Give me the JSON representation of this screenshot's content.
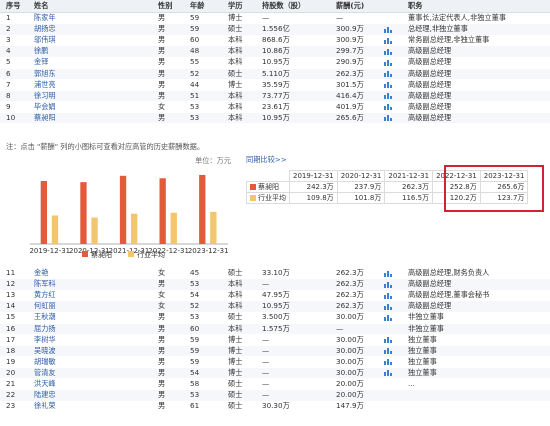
{
  "header": [
    "序号",
    "姓名",
    "性别",
    "年龄",
    "学历",
    "持股数（股）",
    "薪酬(元)",
    "",
    "职务"
  ],
  "top_rows": [
    [
      "1",
      "陈家年",
      "男",
      "59",
      "博士",
      "—",
      "—",
      "",
      "董事长,法定代表人,非独立董事"
    ],
    [
      "2",
      "胡扬忠",
      "男",
      "59",
      "硕士",
      "1.556亿",
      "300.9万",
      "chart",
      "总经理,非独立董事"
    ],
    [
      "3",
      "邬伟琪",
      "男",
      "60",
      "本科",
      "868.6万",
      "300.9万",
      "chart",
      "常务副总经理,非独立董事"
    ],
    [
      "4",
      "徐鹏",
      "男",
      "48",
      "本科",
      "10.86万",
      "299.7万",
      "chart",
      "高级副总经理"
    ],
    [
      "5",
      "金铎",
      "男",
      "55",
      "本科",
      "10.95万",
      "290.9万",
      "chart",
      "高级副总经理"
    ],
    [
      "6",
      "郭旭东",
      "男",
      "52",
      "硕士",
      "5.110万",
      "262.3万",
      "chart",
      "高级副总经理"
    ],
    [
      "7",
      "浦世亮",
      "男",
      "44",
      "博士",
      "35.59万",
      "301.5万",
      "chart",
      "高级副总经理"
    ],
    [
      "8",
      "徐习明",
      "男",
      "51",
      "本科",
      "73.77万",
      "416.4万",
      "chart",
      "高级副总经理"
    ],
    [
      "9",
      "毕会娟",
      "女",
      "53",
      "本科",
      "23.61万",
      "401.9万",
      "chart",
      "高级副总经理"
    ],
    [
      "10",
      "蔡昶阳",
      "男",
      "53",
      "本科",
      "10.95万",
      "265.6万",
      "chart",
      "高级副总经理"
    ]
  ],
  "note": "注：点击 \"薪酬\" 列的小图标可查看对应高管的历史薪酬数据。",
  "salary_panel": {
    "unit": "单位：万元",
    "compare_title": "同期比较>>",
    "years": [
      "2019-12-31",
      "2020-12-31",
      "2021-12-31",
      "2022-12-31",
      "2023-12-31"
    ],
    "rows": [
      {
        "name": "蔡昶阳",
        "values": [
          "242.3万",
          "237.9万",
          "262.3万",
          "252.8万",
          "265.6万"
        ]
      },
      {
        "name": "行业平均",
        "values": [
          "109.8万",
          "101.8万",
          "116.5万",
          "120.2万",
          "123.7万"
        ]
      }
    ],
    "legend": [
      "蔡昶阳",
      "行业平均"
    ]
  },
  "chart_data": {
    "type": "bar",
    "categories": [
      "2019-12-31",
      "2020-12-31",
      "2021-12-31",
      "2022-12-31",
      "2023-12-31"
    ],
    "series": [
      {
        "name": "蔡昶阳",
        "values": [
          242.3,
          237.9,
          262.3,
          252.8,
          265.6
        ]
      },
      {
        "name": "行业平均",
        "values": [
          109.8,
          101.8,
          116.5,
          120.2,
          123.7
        ]
      }
    ],
    "colors": [
      "#e45b3c",
      "#f2c66d"
    ],
    "ylim": [
      0,
      300
    ],
    "ylabel": "单位：万元"
  },
  "bottom_rows": [
    [
      "11",
      "金艳",
      "女",
      "45",
      "硕士",
      "33.10万",
      "262.3万",
      "chart",
      "高级副总经理,财务负责人"
    ],
    [
      "12",
      "陈军科",
      "男",
      "53",
      "本科",
      "—",
      "262.3万",
      "chart",
      "高级副总经理"
    ],
    [
      "13",
      "黄方红",
      "女",
      "54",
      "本科",
      "47.95万",
      "262.3万",
      "chart",
      "高级副总经理,董事会秘书"
    ],
    [
      "14",
      "何虹丽",
      "女",
      "52",
      "本科",
      "10.95万",
      "262.3万",
      "chart",
      "高级副总经理"
    ],
    [
      "15",
      "王秋潮",
      "男",
      "53",
      "硕士",
      "3.500万",
      "30.00万",
      "chart",
      "非独立董事"
    ],
    [
      "16",
      "屈力扬",
      "男",
      "60",
      "本科",
      "1.575万",
      "—",
      "",
      "非独立董事"
    ],
    [
      "17",
      "李树华",
      "男",
      "59",
      "博士",
      "—",
      "30.00万",
      "chart",
      "独立董事"
    ],
    [
      "18",
      "吴晓波",
      "男",
      "59",
      "博士",
      "—",
      "30.00万",
      "chart",
      "独立董事"
    ],
    [
      "19",
      "胡瑞敏",
      "男",
      "59",
      "博士",
      "—",
      "30.00万",
      "chart",
      "独立董事"
    ],
    [
      "20",
      "管清友",
      "男",
      "54",
      "博士",
      "—",
      "30.00万",
      "chart",
      "独立董事"
    ],
    [
      "21",
      "洪天峰",
      "男",
      "58",
      "硕士",
      "—",
      "20.00万",
      "",
      "..."
    ],
    [
      "22",
      "陆建忠",
      "男",
      "53",
      "硕士",
      "—",
      "20.00万",
      "",
      ""
    ],
    [
      "23",
      "徐礼荣",
      "男",
      "61",
      "硕士",
      "30.30万",
      "147.9万",
      "",
      ""
    ]
  ],
  "watermark": "新浪财经"
}
